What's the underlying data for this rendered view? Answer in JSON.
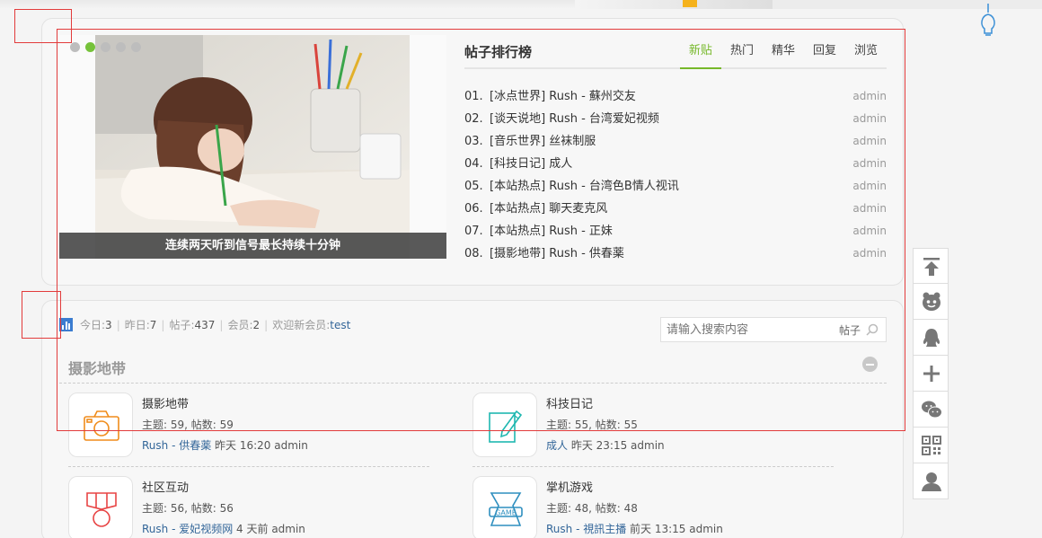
{
  "slider": {
    "caption": "连续两天听到信号最长持续十分钟",
    "dots": [
      false,
      true,
      false,
      false,
      false
    ]
  },
  "ranking": {
    "title": "帖子排行榜",
    "tabs": [
      {
        "label": "新贴",
        "active": true
      },
      {
        "label": "热门",
        "active": false
      },
      {
        "label": "精华",
        "active": false
      },
      {
        "label": "回复",
        "active": false
      },
      {
        "label": "浏览",
        "active": false
      }
    ],
    "items": [
      {
        "num": "01.",
        "text": "[冰点世界] Rush - 蘇州交友",
        "author": "admin"
      },
      {
        "num": "02.",
        "text": "[谈天说地] Rush - 台湾爱妃视频",
        "author": "admin"
      },
      {
        "num": "03.",
        "text": "[音乐世界] 丝袜制服",
        "author": "admin"
      },
      {
        "num": "04.",
        "text": "[科技日记] 成人",
        "author": "admin"
      },
      {
        "num": "05.",
        "text": "[本站热点] Rush - 台湾色B情人视讯",
        "author": "admin"
      },
      {
        "num": "06.",
        "text": "[本站热点] 聊天麦克风",
        "author": "admin"
      },
      {
        "num": "07.",
        "text": "[本站热点] Rush - 正妹",
        "author": "admin"
      },
      {
        "num": "08.",
        "text": "[摄影地带] Rush - 供春薬",
        "author": "admin"
      }
    ]
  },
  "stats": {
    "today_label": "今日: ",
    "today": "3",
    "yesterday_label": "昨日: ",
    "yesterday": "7",
    "posts_label": "帖子: ",
    "posts": "437",
    "members_label": "会员: ",
    "members": "2",
    "welcome_label": "欢迎新会员: ",
    "newest": "test"
  },
  "search": {
    "placeholder": "请输入搜索内容",
    "scope": "帖子"
  },
  "section": {
    "title": "摄影地带"
  },
  "forums": [
    {
      "name": "摄影地带",
      "topics": "主题: 59, 帖数: 59",
      "last_link": "Rush - 供春薬",
      "last_info": " 昨天 16:20 admin",
      "icon": "camera-icon",
      "color": "#f08c1a"
    },
    {
      "name": "科技日记",
      "topics": "主题: 55, 帖数: 55",
      "last_link": "成人",
      "last_info": " 昨天 23:15 admin",
      "icon": "pen-tablet-icon",
      "color": "#1fb7b0"
    },
    {
      "name": "社区互动",
      "topics": "主题: 56, 帖数: 56",
      "last_link": "Rush - 爱妃视频网",
      "last_info": " 4 天前 admin",
      "icon": "badge-icon",
      "color": "#e84545"
    },
    {
      "name": "掌机游戏",
      "topics": "主题: 48, 帖数: 48",
      "last_link": "Rush - 視訊主播",
      "last_info": " 前天 13:15 admin",
      "icon": "game-icon",
      "color": "#2f8fbf"
    }
  ],
  "tools": [
    "back-to-top-icon",
    "mascot-icon",
    "qq-icon",
    "add-icon",
    "wechat-icon",
    "qrcode-icon",
    "user-icon"
  ]
}
